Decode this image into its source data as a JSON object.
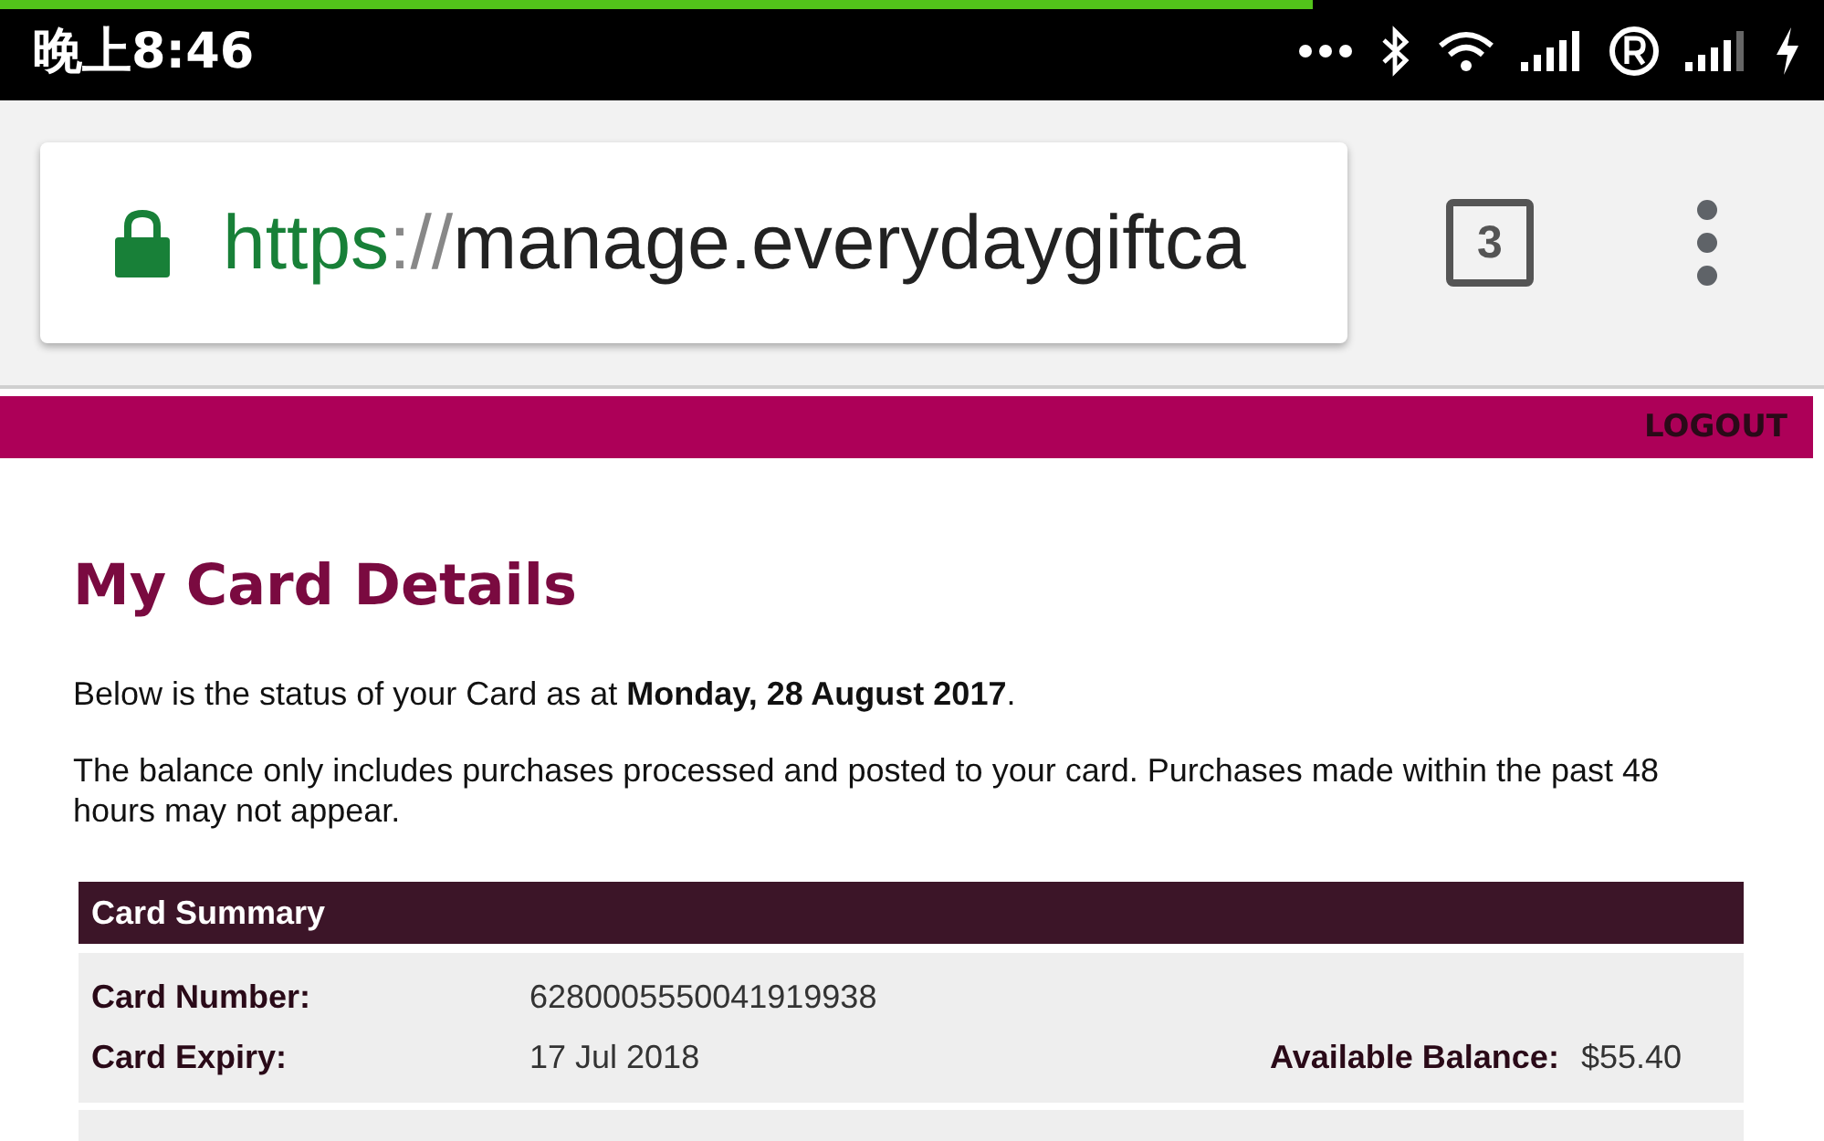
{
  "status_bar": {
    "time": "晚上8:46",
    "page_load": {
      "level": 0.72
    }
  },
  "browser": {
    "url": {
      "scheme": "https",
      "separator": "://",
      "host": "manage.everydaygiftca"
    },
    "tab_count": "3"
  },
  "header": {
    "logout": "LOGOUT"
  },
  "page": {
    "title": "My Card Details",
    "status_text": "Below is the status of your Card as at **Monday, 28 August 2017**.",
    "note": "The balance only includes purchases processed and posted to your card. Purchases made within the past 48 hours may not appear."
  },
  "card_summary": {
    "heading": "Card Summary",
    "number_label": "Card Number:",
    "number": "6280005550041919938",
    "expiry_label": "Card Expiry:",
    "expiry": "17 Jul 2018",
    "balance_label": "Available Balance:",
    "balance": "$55.40"
  }
}
